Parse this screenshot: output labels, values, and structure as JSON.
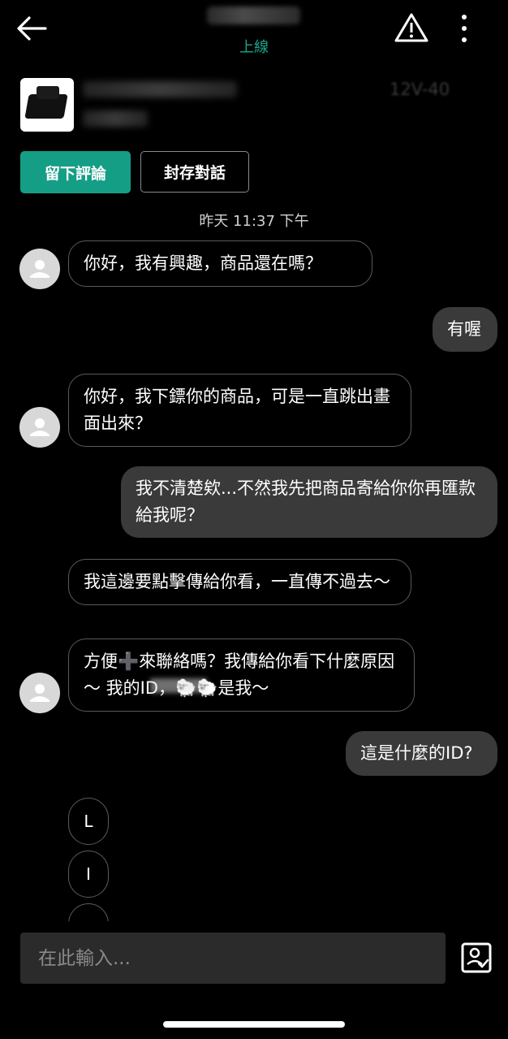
{
  "header": {
    "status": "上線",
    "back_icon": "arrow-left-icon",
    "report_icon": "warning-triangle-icon",
    "more_icon": "more-vertical-icon"
  },
  "product": {
    "title_visible_tail": "12V-40",
    "review_button": "留下評論",
    "archive_button": "封存對話"
  },
  "timestamp": "昨天 11:37 下午",
  "messages": [
    {
      "side": "in",
      "text": "你好，我有興趣，商品還在嗎？"
    },
    {
      "side": "out",
      "text": "有喔"
    },
    {
      "side": "in",
      "text": "你好，我下鏢你的商品，可是一直跳出畫面出來？"
    },
    {
      "side": "out",
      "text": "我不清楚欸...不然我先把商品寄給你你再匯款給我呢？"
    },
    {
      "side": "in",
      "text": "我這邊要點擊傳給你看，一直傳不過去～"
    },
    {
      "side": "in",
      "text": "方便➕來聯絡嗎？我傳給你看下什麼原因～ 我的ID，🐑🐑是我～"
    },
    {
      "side": "out",
      "text": "這是什麼的ID?"
    },
    {
      "side": "in",
      "text": "L"
    },
    {
      "side": "in",
      "text": "I"
    }
  ],
  "composer": {
    "placeholder": "在此輸入...",
    "attach_icon": "photo-icon"
  },
  "colors": {
    "accent": "#159e86",
    "status": "#1aa58e",
    "outgoing_bubble": "#3a3a3a",
    "input_bg": "#2b2b2b"
  }
}
